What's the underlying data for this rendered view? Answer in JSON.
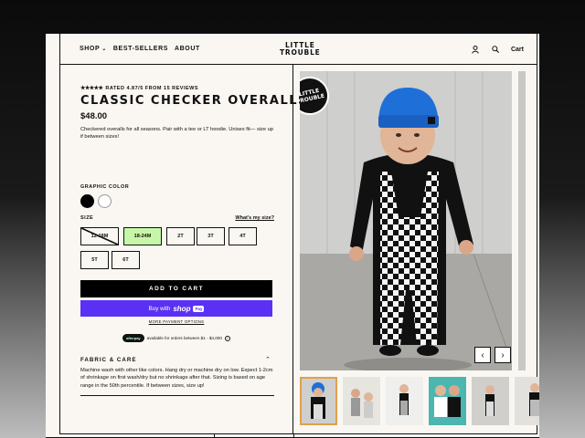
{
  "nav": {
    "shop": "SHOP",
    "best_sellers": "BEST-SELLERS",
    "about": "ABOUT",
    "logo_line1": "LITTLE",
    "logo_line2": "TROUBLE",
    "cart": "Cart"
  },
  "product": {
    "stars": "★★★★★",
    "rating": "RATED 4.87/5 FROM 15 REVIEWS",
    "title": "CLASSIC CHECKER OVERALLS",
    "price": "$48.00",
    "description": "Checkered overalls for all seasons. Pair with a tee or LT hoodie. Unisex fit— size up if between sizes!",
    "color_label": "GRAPHIC COLOR",
    "colors": [
      "#000000",
      "#ffffff"
    ],
    "size_label": "SIZE",
    "size_guide": "What's my size?",
    "sizes": [
      "12-18M",
      "18-24M",
      "2T",
      "3T",
      "4T",
      "5T",
      "6T"
    ],
    "selected_size": "18-24M",
    "add_to_cart": "ADD TO CART",
    "buy_with": "Buy with",
    "shop_word": "shop",
    "pay_word": "Pay",
    "more_payment": "MORE PAYMENT OPTIONS",
    "afterpay_badge": "afterpay",
    "afterpay_text": "available for orders between $1 - $4,000",
    "care_heading": "FABRIC & CARE",
    "care_text": "Machine wash with other like colors. Hang dry or machine dry on low. Expect 1-2cm of shrinkage on first wash/dry but no shrinkage after that. Sizing is based on age range in the 50th percentile. If between sizes, size up!"
  },
  "gallery": {
    "badge_line1": "LITTLE",
    "badge_line2": "TROUBLE",
    "thumb_count": 6
  },
  "colors": {
    "accent_green": "#c7f7a6",
    "shop_pay": "#5a31f4",
    "beanie_blue": "#1f6fd8"
  }
}
